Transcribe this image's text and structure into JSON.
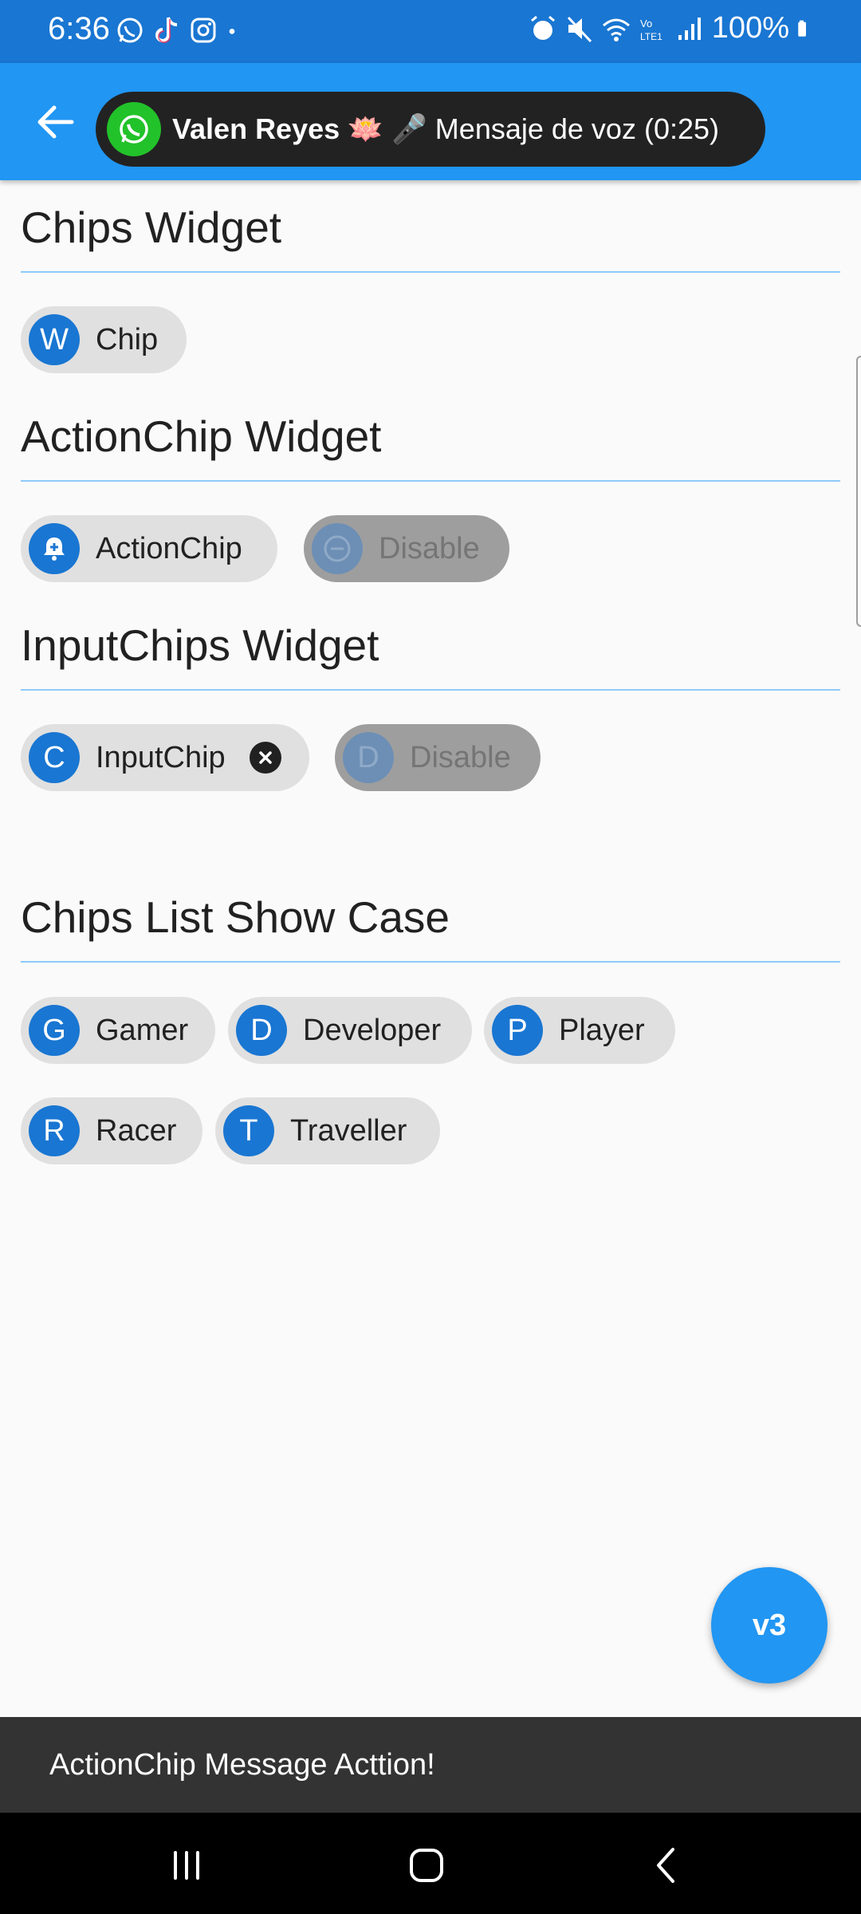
{
  "status_bar": {
    "time": "6:36",
    "battery": "100%",
    "left_icons": [
      "whatsapp-icon",
      "tiktok-icon",
      "instagram-icon",
      "dot-icon"
    ],
    "right_icons": [
      "alarm-icon",
      "mute-icon",
      "wifi-icon",
      "volte-icon",
      "signal-icon",
      "battery-icon"
    ]
  },
  "app_bar": {
    "notification": {
      "sender": "Valen Reyes 🪷",
      "message": "🎤 Mensaje de voz (0:25)"
    }
  },
  "sections": {
    "chips": {
      "title": "Chips Widget"
    },
    "action_chips": {
      "title": "ActionChip Widget"
    },
    "input_chips": {
      "title": "InputChips Widget"
    },
    "show_case": {
      "title": "Chips List Show Case"
    }
  },
  "chips": {
    "chip": {
      "avatar": "W",
      "label": "Chip"
    },
    "action_chip": {
      "label": "ActionChip"
    },
    "action_disabled": {
      "label": "Disable"
    },
    "input_chip": {
      "avatar": "C",
      "label": "InputChip"
    },
    "input_disabled": {
      "avatar": "D",
      "label": "Disable"
    }
  },
  "show_case": [
    {
      "avatar": "G",
      "label": "Gamer"
    },
    {
      "avatar": "D",
      "label": "Developer"
    },
    {
      "avatar": "P",
      "label": "Player"
    },
    {
      "avatar": "R",
      "label": "Racer"
    },
    {
      "avatar": "T",
      "label": "Traveller"
    }
  ],
  "fab": {
    "label": "v3"
  },
  "snackbar": {
    "message": "ActionChip Message Acttion!"
  },
  "colors": {
    "status_bar": "#1976d2",
    "app_bar": "#2196f3",
    "avatar": "#1976d2",
    "chip": "#e0e0e0",
    "chip_disabled": "#9e9e9e",
    "snackbar": "#333333",
    "fab": "#2196f3"
  }
}
